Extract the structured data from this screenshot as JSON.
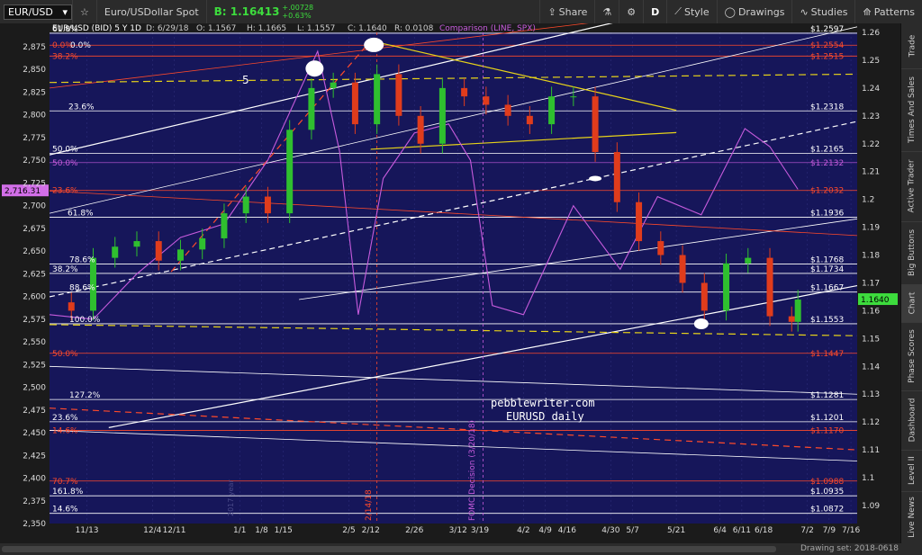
{
  "toolbar": {
    "symbol": "EUR/USD",
    "description": "Euro/USDollar Spot",
    "bid_label": "B: 1.16413",
    "change_abs": "+.00728",
    "change_pct": "+0.63%",
    "share": "Share",
    "period": "D",
    "style": "Style",
    "drawings": "Drawings",
    "studies": "Studies",
    "patterns": "Patterns"
  },
  "sidebar": {
    "tabs": [
      "Trade",
      "Times And Sales",
      "Active Trader",
      "Big Buttons",
      "Chart",
      "Phase Scores",
      "Dashboard",
      "Level II",
      "Live News"
    ]
  },
  "footer": {
    "drawing_set": "Drawing set: 2018-0618"
  },
  "colors": {
    "background": "#16165a",
    "up_candle": "#2fbf2f",
    "down_candle": "#e03c1c",
    "comparison": "#c65bdc",
    "fib_white": "#ffffff",
    "fib_red": "#ff4a2a",
    "trend_yellow": "#e6d21a"
  },
  "chart_data": {
    "type": "candlestick",
    "title": "EUR/USD (BID) 5 Y 1D",
    "header_stats": {
      "date": "D: 6/29/18",
      "open": "O: 1.1567",
      "high": "H: 1.1665",
      "low": "L: 1.1557",
      "close": "C: 1.1640",
      "change": "R: 0.0108"
    },
    "comparison_label": "Comparison (LINE, SPX)",
    "y_right": {
      "min": 1.09,
      "max": 1.26,
      "ticks": [
        1.26,
        1.25,
        1.24,
        1.23,
        1.22,
        1.21,
        1.2,
        1.19,
        1.18,
        1.17,
        1.16,
        1.15,
        1.14,
        1.13,
        1.12,
        1.11,
        1.1,
        1.09
      ]
    },
    "y_left": {
      "min": 2350,
      "max": 2875,
      "ticks": [
        2875,
        2850,
        2825,
        2800,
        2775,
        2750,
        2725,
        2700,
        2675,
        2650,
        2625,
        2600,
        2575,
        2550,
        2525,
        2500,
        2475,
        2450,
        2425,
        2400,
        2375,
        2350
      ]
    },
    "x_labels": [
      {
        "label": "11/13",
        "date": "2017-11-13"
      },
      {
        "label": "12/4",
        "date": "2017-12-04"
      },
      {
        "label": "12/11",
        "date": "2017-12-11"
      },
      {
        "label": "1/1",
        "date": "2018-01-01"
      },
      {
        "label": "1/8",
        "date": "2018-01-08"
      },
      {
        "label": "1/15",
        "date": "2018-01-15"
      },
      {
        "label": "2/5",
        "date": "2018-02-05"
      },
      {
        "label": "2/12",
        "date": "2018-02-12"
      },
      {
        "label": "2/26",
        "date": "2018-02-26"
      },
      {
        "label": "3/12",
        "date": "2018-03-12"
      },
      {
        "label": "3/19",
        "date": "2018-03-19"
      },
      {
        "label": "4/2",
        "date": "2018-04-02"
      },
      {
        "label": "4/9",
        "date": "2018-04-09"
      },
      {
        "label": "4/16",
        "date": "2018-04-16"
      },
      {
        "label": "4/30",
        "date": "2018-04-30"
      },
      {
        "label": "5/7",
        "date": "2018-05-07"
      },
      {
        "label": "5/21",
        "date": "2018-05-21"
      },
      {
        "label": "6/4",
        "date": "2018-06-04"
      },
      {
        "label": "6/11",
        "date": "2018-06-11"
      },
      {
        "label": "6/18",
        "date": "2018-06-18"
      },
      {
        "label": "7/2",
        "date": "2018-07-02"
      },
      {
        "label": "7/9",
        "date": "2018-07-09"
      },
      {
        "label": "7/16",
        "date": "2018-07-16"
      }
    ],
    "price_levels_white": [
      {
        "price": 1.2597,
        "label": "$1.2597"
      },
      {
        "price": 1.2318,
        "label": "$1.2318"
      },
      {
        "price": 1.2165,
        "label": "$1.2165"
      },
      {
        "price": 1.1936,
        "label": "$1.1936"
      },
      {
        "price": 1.1768,
        "label": "$1.1768"
      },
      {
        "price": 1.1734,
        "label": "$1.1734"
      },
      {
        "price": 1.1667,
        "label": "$1.1667"
      },
      {
        "price": 1.1553,
        "label": "$1.1553"
      },
      {
        "price": 1.1281,
        "label": "$1.1281"
      },
      {
        "price": 1.1201,
        "label": "$1.1201"
      },
      {
        "price": 1.0935,
        "label": "$1.0935"
      },
      {
        "price": 1.0872,
        "label": "$1.0872"
      }
    ],
    "price_levels_red": [
      {
        "price": 1.2554,
        "label": "$1.2554"
      },
      {
        "price": 1.2515,
        "label": "$1.2515"
      },
      {
        "price": 1.2032,
        "label": "$1.2032"
      },
      {
        "price": 1.1447,
        "label": "$1.1447"
      },
      {
        "price": 1.117,
        "label": "$1.1170"
      },
      {
        "price": 1.0988,
        "label": "$1.0988"
      }
    ],
    "comparison_levels": [
      {
        "price": 1.2132,
        "label": "$1.2132"
      }
    ],
    "fib_labels_white": [
      {
        "price": 1.2597,
        "label": "61.8%"
      },
      {
        "price": 1.2318,
        "label": "23.6%"
      },
      {
        "price": 1.2165,
        "label": "50.0%"
      },
      {
        "price": 1.1936,
        "label": "61.8%"
      },
      {
        "price": 1.1768,
        "label": "78.6%"
      },
      {
        "price": 1.1734,
        "label": "38.2%"
      },
      {
        "price": 1.1667,
        "label": "88.6%"
      },
      {
        "price": 1.1553,
        "label": "100.0%"
      },
      {
        "price": 1.1281,
        "label": "127.2%"
      },
      {
        "price": 1.1201,
        "label": "23.6%"
      },
      {
        "price": 1.0935,
        "label": "161.8%"
      },
      {
        "price": 1.0872,
        "label": "14.6%"
      }
    ],
    "fib_labels_red": [
      {
        "price": 1.2554,
        "label": "0.0%"
      },
      {
        "price": 1.2515,
        "label": "38.2%"
      },
      {
        "price": 1.2132,
        "label": "50.0%"
      },
      {
        "price": 1.2032,
        "label": "23.6%"
      },
      {
        "price": 1.1447,
        "label": "50.0%"
      },
      {
        "price": 1.117,
        "label": "14.6%"
      },
      {
        "price": 1.0988,
        "label": "70.7%"
      }
    ],
    "extra_label_00": "0.0%",
    "last_price": {
      "price": 1.164,
      "label": "1.1640"
    },
    "left_value": {
      "value": 2716.31,
      "label": "2,716.31"
    },
    "annotations": [
      {
        "text": "pebblewriter.com"
      },
      {
        "text": "EURUSD daily"
      },
      {
        "text": "5"
      },
      {
        "text": "2/14/18"
      },
      {
        "text": "FOMC Decision (3/20/18)"
      },
      {
        "text": "2017 year"
      }
    ],
    "eur_close": [
      {
        "date": "2017-11-01",
        "value": 1.163
      },
      {
        "date": "2017-11-08",
        "value": 1.16
      },
      {
        "date": "2017-11-15",
        "value": 1.179
      },
      {
        "date": "2017-11-22",
        "value": 1.183
      },
      {
        "date": "2017-11-29",
        "value": 1.185
      },
      {
        "date": "2017-12-06",
        "value": 1.178
      },
      {
        "date": "2017-12-13",
        "value": 1.182
      },
      {
        "date": "2017-12-20",
        "value": 1.186
      },
      {
        "date": "2017-12-27",
        "value": 1.195
      },
      {
        "date": "2018-01-03",
        "value": 1.201
      },
      {
        "date": "2018-01-10",
        "value": 1.195
      },
      {
        "date": "2018-01-17",
        "value": 1.225
      },
      {
        "date": "2018-01-24",
        "value": 1.24
      },
      {
        "date": "2018-01-31",
        "value": 1.242
      },
      {
        "date": "2018-02-07",
        "value": 1.227
      },
      {
        "date": "2018-02-14",
        "value": 1.245
      },
      {
        "date": "2018-02-21",
        "value": 1.23
      },
      {
        "date": "2018-02-28",
        "value": 1.22
      },
      {
        "date": "2018-03-07",
        "value": 1.24
      },
      {
        "date": "2018-03-14",
        "value": 1.237
      },
      {
        "date": "2018-03-21",
        "value": 1.234
      },
      {
        "date": "2018-03-28",
        "value": 1.23
      },
      {
        "date": "2018-04-04",
        "value": 1.227
      },
      {
        "date": "2018-04-11",
        "value": 1.237
      },
      {
        "date": "2018-04-18",
        "value": 1.237
      },
      {
        "date": "2018-04-25",
        "value": 1.217
      },
      {
        "date": "2018-05-02",
        "value": 1.199
      },
      {
        "date": "2018-05-09",
        "value": 1.185
      },
      {
        "date": "2018-05-16",
        "value": 1.18
      },
      {
        "date": "2018-05-23",
        "value": 1.17
      },
      {
        "date": "2018-05-30",
        "value": 1.16
      },
      {
        "date": "2018-06-06",
        "value": 1.177
      },
      {
        "date": "2018-06-13",
        "value": 1.179
      },
      {
        "date": "2018-06-20",
        "value": 1.158
      },
      {
        "date": "2018-06-27",
        "value": 1.156
      },
      {
        "date": "2018-06-29",
        "value": 1.164
      }
    ],
    "spx_close": [
      {
        "date": "2017-11-01",
        "value": 2580
      },
      {
        "date": "2017-11-15",
        "value": 2575
      },
      {
        "date": "2017-11-29",
        "value": 2625
      },
      {
        "date": "2017-12-13",
        "value": 2665
      },
      {
        "date": "2017-12-27",
        "value": 2680
      },
      {
        "date": "2018-01-10",
        "value": 2750
      },
      {
        "date": "2018-01-26",
        "value": 2870
      },
      {
        "date": "2018-02-02",
        "value": 2760
      },
      {
        "date": "2018-02-08",
        "value": 2580
      },
      {
        "date": "2018-02-16",
        "value": 2730
      },
      {
        "date": "2018-02-26",
        "value": 2780
      },
      {
        "date": "2018-03-09",
        "value": 2790
      },
      {
        "date": "2018-03-16",
        "value": 2750
      },
      {
        "date": "2018-03-23",
        "value": 2590
      },
      {
        "date": "2018-04-02",
        "value": 2580
      },
      {
        "date": "2018-04-18",
        "value": 2700
      },
      {
        "date": "2018-05-03",
        "value": 2630
      },
      {
        "date": "2018-05-15",
        "value": 2710
      },
      {
        "date": "2018-05-29",
        "value": 2690
      },
      {
        "date": "2018-06-12",
        "value": 2785
      },
      {
        "date": "2018-06-20",
        "value": 2765
      },
      {
        "date": "2018-06-29",
        "value": 2718
      }
    ]
  }
}
